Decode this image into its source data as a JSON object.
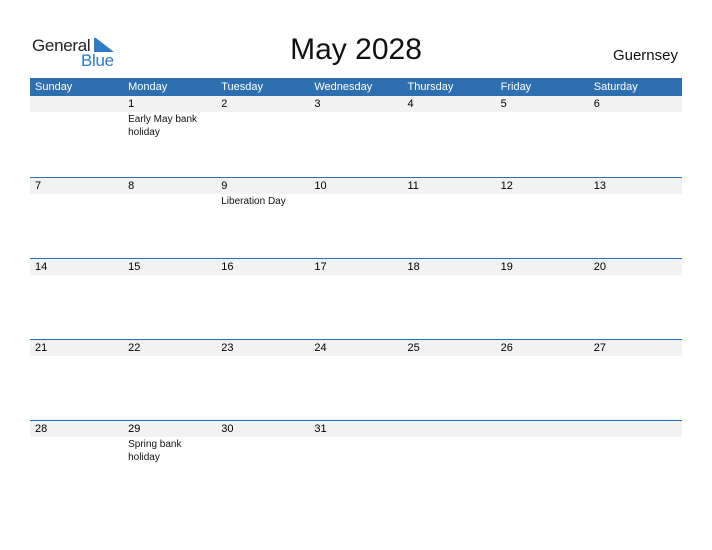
{
  "logo": {
    "general": "General",
    "blue": "Blue",
    "icon": "flag-triangle-icon"
  },
  "title": "May 2028",
  "country": "Guernsey",
  "colors": {
    "header_bg": "#2e6fb0",
    "date_row_bg": "#f2f2f2",
    "logo_blue": "#2f7ac3"
  },
  "weekdays": [
    "Sunday",
    "Monday",
    "Tuesday",
    "Wednesday",
    "Thursday",
    "Friday",
    "Saturday"
  ],
  "weeks": [
    {
      "days": [
        {
          "num": "",
          "holiday": ""
        },
        {
          "num": "1",
          "holiday": "Early May bank holiday"
        },
        {
          "num": "2",
          "holiday": ""
        },
        {
          "num": "3",
          "holiday": ""
        },
        {
          "num": "4",
          "holiday": ""
        },
        {
          "num": "5",
          "holiday": ""
        },
        {
          "num": "6",
          "holiday": ""
        }
      ]
    },
    {
      "days": [
        {
          "num": "7",
          "holiday": ""
        },
        {
          "num": "8",
          "holiday": ""
        },
        {
          "num": "9",
          "holiday": "Liberation Day"
        },
        {
          "num": "10",
          "holiday": ""
        },
        {
          "num": "11",
          "holiday": ""
        },
        {
          "num": "12",
          "holiday": ""
        },
        {
          "num": "13",
          "holiday": ""
        }
      ]
    },
    {
      "days": [
        {
          "num": "14",
          "holiday": ""
        },
        {
          "num": "15",
          "holiday": ""
        },
        {
          "num": "16",
          "holiday": ""
        },
        {
          "num": "17",
          "holiday": ""
        },
        {
          "num": "18",
          "holiday": ""
        },
        {
          "num": "19",
          "holiday": ""
        },
        {
          "num": "20",
          "holiday": ""
        }
      ]
    },
    {
      "days": [
        {
          "num": "21",
          "holiday": ""
        },
        {
          "num": "22",
          "holiday": ""
        },
        {
          "num": "23",
          "holiday": ""
        },
        {
          "num": "24",
          "holiday": ""
        },
        {
          "num": "25",
          "holiday": ""
        },
        {
          "num": "26",
          "holiday": ""
        },
        {
          "num": "27",
          "holiday": ""
        }
      ]
    },
    {
      "days": [
        {
          "num": "28",
          "holiday": ""
        },
        {
          "num": "29",
          "holiday": "Spring bank holiday"
        },
        {
          "num": "30",
          "holiday": ""
        },
        {
          "num": "31",
          "holiday": ""
        },
        {
          "num": "",
          "holiday": ""
        },
        {
          "num": "",
          "holiday": ""
        },
        {
          "num": "",
          "holiday": ""
        }
      ]
    }
  ]
}
